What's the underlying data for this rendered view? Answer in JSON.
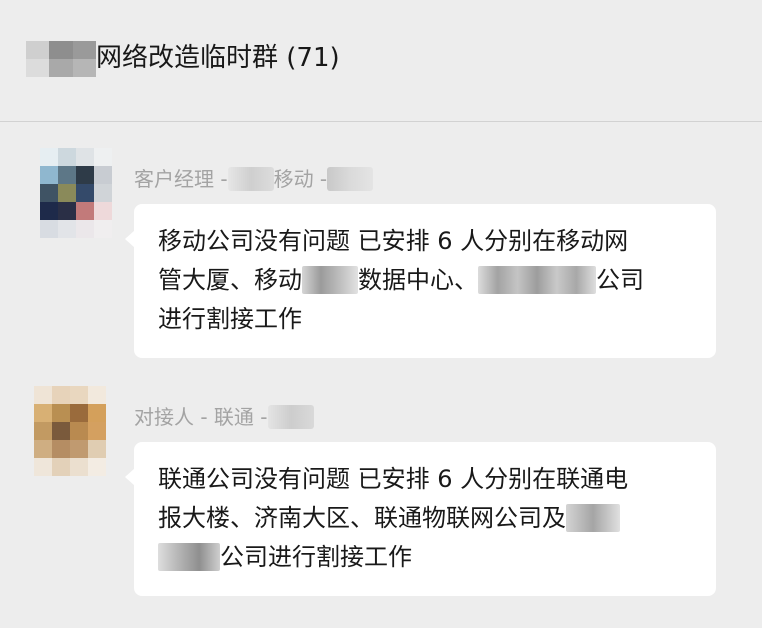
{
  "header": {
    "title": "网络改造临时群 (71)"
  },
  "messages": [
    {
      "sender": {
        "part1": "客户经理 - ",
        "part2": "移动 - "
      },
      "lines": [
        {
          "pre": "移动公司没有问题 已安排 6 人分别在移动网",
          "post": ""
        },
        {
          "pre": "管大厦、移动",
          "mid": "数据中心、",
          "post": "公司"
        },
        {
          "pre": "进行割接工作",
          "post": ""
        }
      ]
    },
    {
      "sender": {
        "part1": "对接人 - 联通 - "
      },
      "lines": [
        {
          "pre": "联通公司没有问题 已安排 6 人分别在联通电",
          "post": ""
        },
        {
          "pre": "报大楼、济南大区、联通物联网公司及",
          "post": ""
        },
        {
          "pre": "",
          "post": "公司进行割接工作"
        }
      ]
    }
  ],
  "colors": {
    "background": "#ededed",
    "bubble": "#ffffff",
    "sender_text": "#a3a3a3",
    "message_text": "#191919"
  }
}
